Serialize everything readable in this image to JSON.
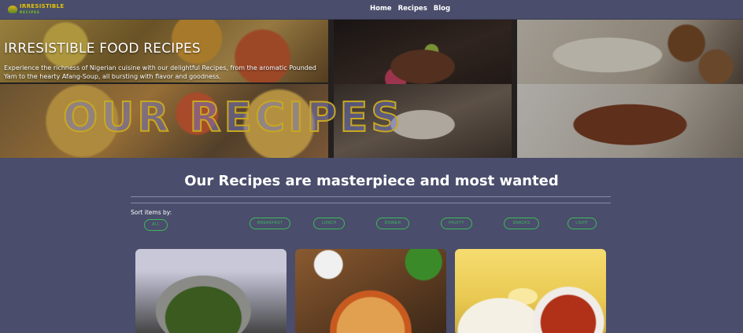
{
  "nav": {
    "logo_text": "IRRESISTIBLE",
    "logo_sub": "RECIPES",
    "links": [
      {
        "label": "Home"
      },
      {
        "label": "Recipes"
      },
      {
        "label": "Blog"
      }
    ]
  },
  "hero": {
    "title": "IRRESISTIBLE FOOD RECIPES",
    "description": "Experience the richness of Nigerian cuisine with our delightful Recipes, from the aromatic Pounded Yam to the hearty Afang-Soup, all bursting with flavor and goodness.",
    "overlay": "OUR RECIPES"
  },
  "section": {
    "title": "Our Recipes are masterpiece and most wanted",
    "sort_label": "Sort items by:"
  },
  "filters": [
    {
      "label": "all"
    },
    {
      "label": "breakfast"
    },
    {
      "label": "lunch"
    },
    {
      "label": "dinner"
    },
    {
      "label": "fruity"
    },
    {
      "label": "snacks"
    },
    {
      "label": "light"
    }
  ],
  "colors": {
    "background": "#4a4d6b",
    "accent": "#3dbb5a",
    "logo": "#e9b820"
  }
}
